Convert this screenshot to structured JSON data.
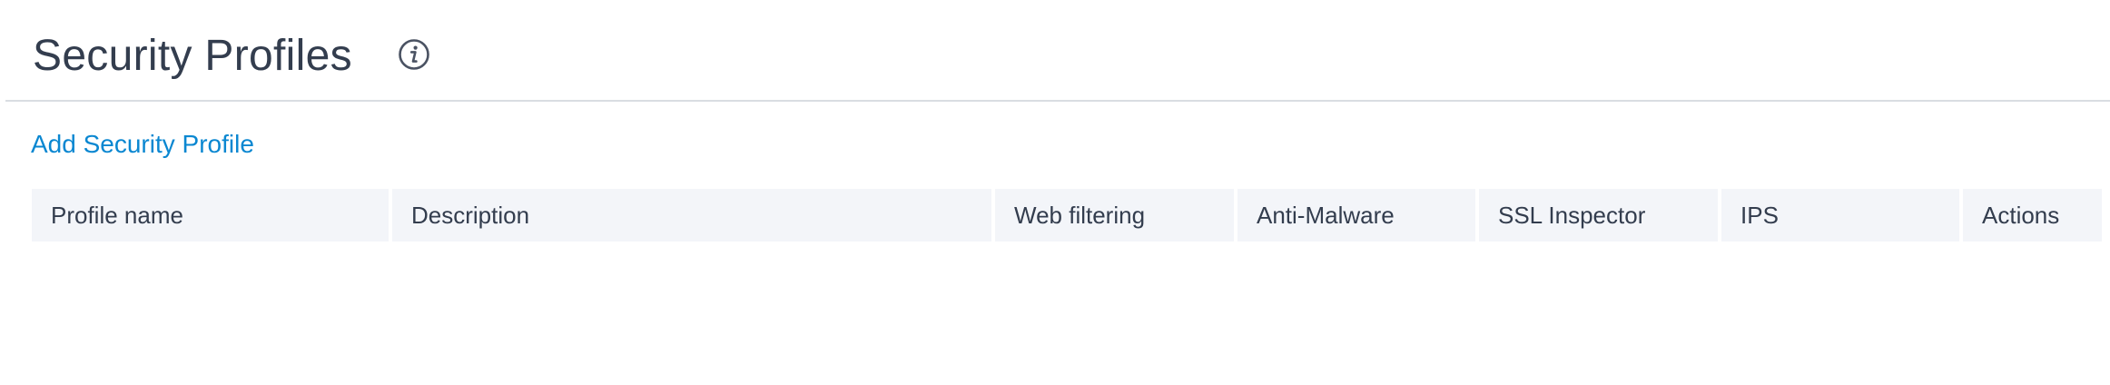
{
  "header": {
    "title": "Security Profiles",
    "info_icon": "info-circle-icon"
  },
  "actions": {
    "add_label": "Add Security Profile"
  },
  "table": {
    "columns": [
      "Profile name",
      "Description",
      "Web filtering",
      "Anti-Malware",
      "SSL Inspector",
      "IPS",
      "Actions"
    ],
    "rows": []
  },
  "colors": {
    "link": "#0a87d1",
    "header_bg": "#f3f5f9",
    "text": "#333d4e",
    "divider": "#d9dde2"
  }
}
